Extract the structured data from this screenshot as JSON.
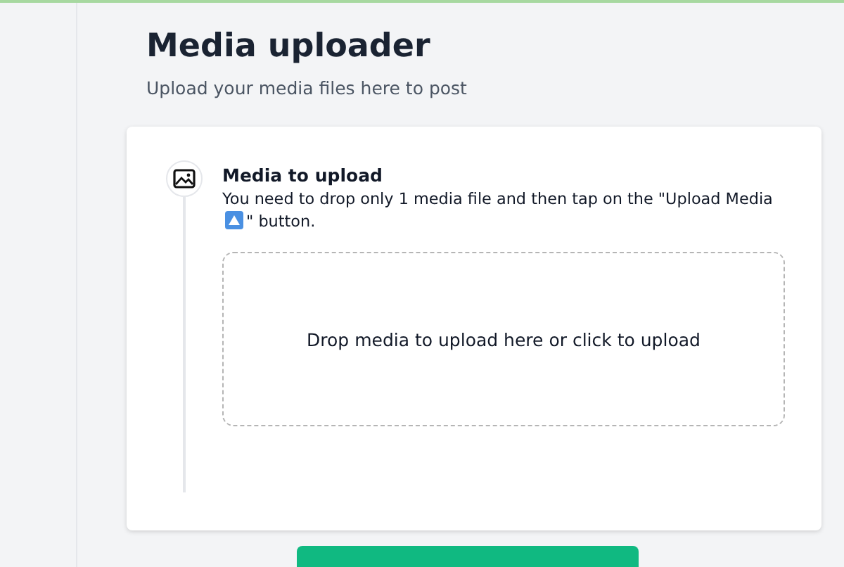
{
  "header": {
    "title": "Media uploader",
    "subtitle": "Upload your media files here to post"
  },
  "step": {
    "title": "Media to upload",
    "description_before": "You need to drop only 1 media file and then tap on the \"Upload Media",
    "description_after": "\" button."
  },
  "dropzone": {
    "text": "Drop media to upload here or click to upload"
  }
}
